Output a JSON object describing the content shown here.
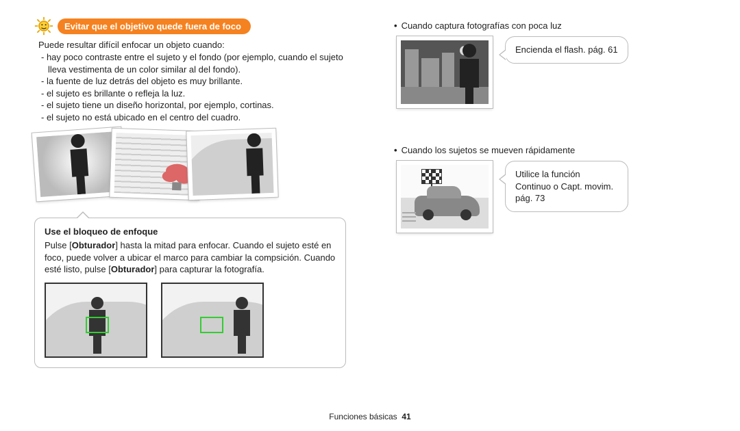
{
  "left": {
    "title": "Evitar que el objetivo quede fuera de foco",
    "intro": "Puede resultar difícil enfocar un objeto cuando:",
    "bullets": [
      "hay poco contraste entre el sujeto y el fondo (por ejemplo, cuando el sujeto lleva vestimenta de un color similar al del fondo).",
      "la fuente de luz detrás del objeto es muy brillante.",
      "el sujeto es brillante o refleja la luz.",
      "el sujeto tiene un diseño horizontal, por ejemplo, cortinas.",
      "el sujeto no está ubicado en el centro del cuadro."
    ],
    "focus": {
      "title": "Use el bloqueo de enfoque",
      "body_pre": "Pulse [",
      "bold1": "Obturador",
      "body_mid": "] hasta la mitad para enfocar. Cuando el sujeto esté en foco, puede volver a ubicar el marco para cambiar la compsición. Cuando esté listo, pulse [",
      "bold2": "Obturador",
      "body_post": "] para capturar la fotografía."
    }
  },
  "right": {
    "item1": {
      "bullet": "Cuando captura fotografías con poca luz",
      "tip": "Encienda el flash. pág. 61"
    },
    "item2": {
      "bullet": "Cuando los sujetos se mueven rápidamente",
      "tip": "Utilice la función Continuo o Capt. movim. pág. 73"
    }
  },
  "footer": {
    "section": "Funciones básicas",
    "page": "41"
  }
}
